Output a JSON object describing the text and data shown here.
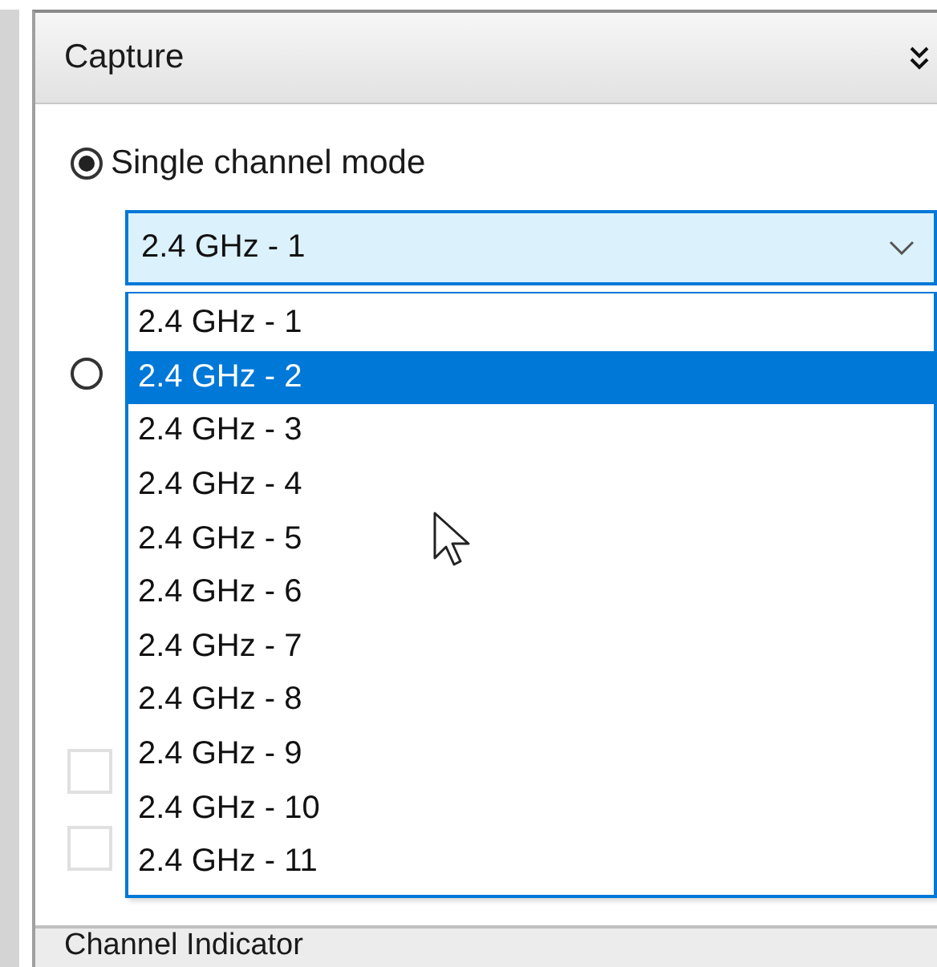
{
  "panel": {
    "title": "Capture",
    "collapsed": false
  },
  "radios": [
    {
      "label": "Single channel mode",
      "selected": true
    },
    {
      "selected": false
    }
  ],
  "channel_select": {
    "value": "2.4 GHz - 1",
    "expanded": true,
    "options": [
      {
        "label": "2.4 GHz - 1",
        "highlighted": false
      },
      {
        "label": "2.4 GHz - 2",
        "highlighted": true
      },
      {
        "label": "2.4 GHz - 3",
        "highlighted": false
      },
      {
        "label": "2.4 GHz - 4",
        "highlighted": false
      },
      {
        "label": "2.4 GHz - 5",
        "highlighted": false
      },
      {
        "label": "2.4 GHz - 6",
        "highlighted": false
      },
      {
        "label": "2.4 GHz - 7",
        "highlighted": false
      },
      {
        "label": "2.4 GHz - 8",
        "highlighted": false
      },
      {
        "label": "2.4 GHz - 9",
        "highlighted": false
      },
      {
        "label": "2.4 GHz - 10",
        "highlighted": false
      },
      {
        "label": "2.4 GHz - 11",
        "highlighted": false
      }
    ]
  },
  "checkboxes": [
    {
      "checked": false
    },
    {
      "checked": false
    }
  ],
  "next_panel": {
    "title": "Channel Indicator"
  }
}
